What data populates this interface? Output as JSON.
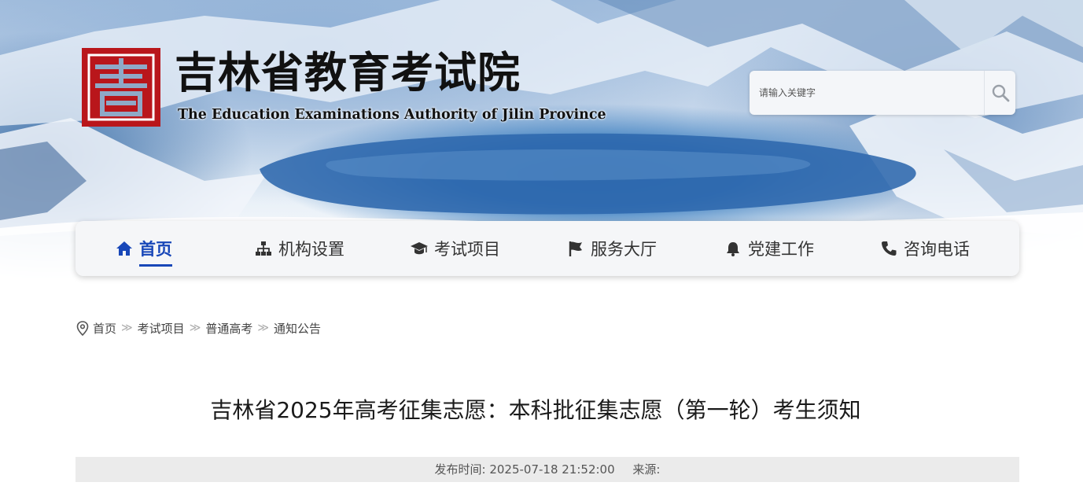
{
  "header": {
    "title": "吉林省教育考试院",
    "subtitle": "The Education Examinations Authority of Jilin Province",
    "logo_color": "#b9161b"
  },
  "search": {
    "placeholder": "请输入关键字",
    "icon": "search-icon"
  },
  "nav": {
    "items": [
      {
        "label": "首页",
        "icon": "home-icon",
        "active": true
      },
      {
        "label": "机构设置",
        "icon": "org-chart-icon"
      },
      {
        "label": "考试项目",
        "icon": "graduation-cap-icon"
      },
      {
        "label": "服务大厅",
        "icon": "flag-icon"
      },
      {
        "label": "党建工作",
        "icon": "bell-icon"
      },
      {
        "label": "咨询电话",
        "icon": "phone-icon"
      }
    ],
    "active_color": "#1847b8"
  },
  "breadcrumb": {
    "icon": "location-pin-icon",
    "items": [
      "首页",
      "考试项目",
      "普通高考",
      "通知公告"
    ]
  },
  "article": {
    "title": "吉林省2025年高考征集志愿：本科批征集志愿（第一轮）考生须知",
    "publish_label": "发布时间: 2025-07-18 21:52:00",
    "source_label": "来源:"
  }
}
